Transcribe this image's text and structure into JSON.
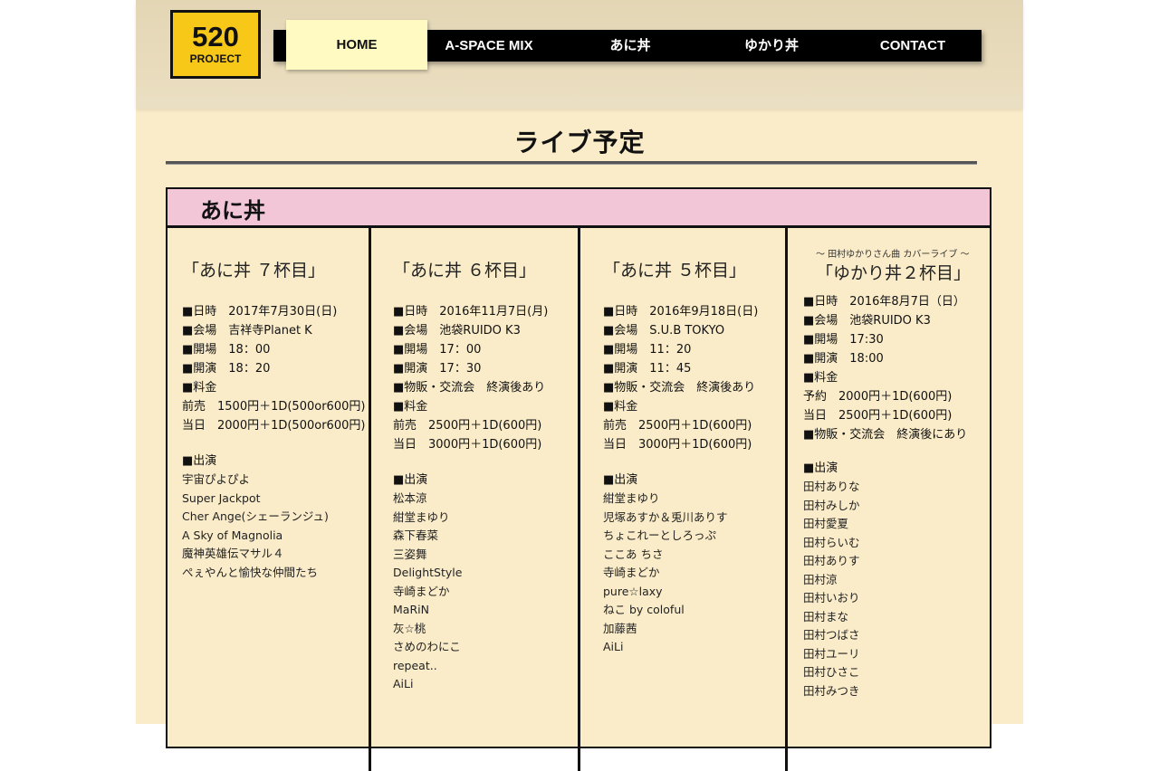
{
  "header": {
    "logo": {
      "number": "520",
      "sub": "PROJECT"
    },
    "nav": [
      {
        "label": "HOME",
        "active": true
      },
      {
        "label": "A-SPACE MIX",
        "active": false
      },
      {
        "label": "あに丼",
        "active": false
      },
      {
        "label": "ゆかり丼",
        "active": false
      },
      {
        "label": "CONTACT",
        "active": false
      }
    ]
  },
  "page_title": "ライブ予定",
  "section": {
    "title": "あに丼",
    "header_color": "#f3c6d7",
    "events": [
      {
        "subtitle": "",
        "title": "「あに丼 ７杯目」",
        "details": [
          "■日時　2017年7月30日(日)",
          "■会場　吉祥寺Planet K",
          "■開場　18：00",
          "■開演　18：20",
          "■料金",
          "前売　1500円＋1D(500or600円)",
          "当日　2000円＋1D(500or600円)"
        ],
        "performers_label": "■出演",
        "performers": [
          "宇宙ぴよぴよ",
          "Super Jackpot",
          "Cher Ange(シェーランジュ)",
          "A Sky of Magnolia",
          "魔神英雄伝マサル４",
          "ぺぇやんと愉快な仲間たち"
        ]
      },
      {
        "subtitle": "",
        "title": "「あに丼 ６杯目」",
        "details": [
          "■日時　2016年11月7日(月)",
          "■会場　池袋RUIDO K3",
          "■開場　17：00",
          "■開演　17：30",
          "■物販・交流会　終演後あり",
          "■料金",
          "前売　2500円＋1D(600円)",
          "当日　3000円＋1D(600円)"
        ],
        "performers_label": "■出演",
        "performers": [
          "松本涼",
          "紺堂まゆり",
          "森下春菜",
          "三姿舞",
          "DelightStyle",
          "寺崎まどか",
          "MaRiN",
          "灰☆桃",
          "さめのわにこ",
          "repeat..",
          "AiLi"
        ]
      },
      {
        "subtitle": "",
        "title": "「あに丼 ５杯目」",
        "details": [
          "■日時　2016年9月18日(日)",
          "■会場　S.U.B TOKYO",
          "■開場　11：20",
          "■開演　11：45",
          "■物販・交流会　終演後あり",
          "■料金",
          "前売　2500円＋1D(600円)",
          "当日　3000円＋1D(600円)"
        ],
        "performers_label": "■出演",
        "performers": [
          "紺堂まゆり",
          "児塚あすか＆兎川ありす",
          "ちょこれーとしろっぷ",
          "ここあ ちさ",
          "寺崎まどか",
          "pure☆laxy",
          "ねこ by coloful",
          "加藤茜",
          "AiLi"
        ]
      },
      {
        "subtitle": "～ 田村ゆかりさん曲 カバーライブ ～",
        "title": "「ゆかり丼２杯目」",
        "details": [
          "■日時　2016年8月7日（日）",
          "■会場　池袋RUIDO K3",
          "■開場　17:30",
          "■開演　18:00",
          "■料金",
          "予約　2000円＋1D(600円)",
          "当日　2500円＋1D(600円)",
          "■物販・交流会　終演後にあり"
        ],
        "performers_label": "■出演",
        "performers": [
          "田村ありな",
          "田村みしか",
          "田村愛夏",
          "田村らいむ",
          "田村ありす",
          "田村涼",
          "田村いおり",
          "田村まな",
          "田村つばさ",
          "田村ユーリ",
          "田村ひさこ",
          "田村みつき"
        ]
      }
    ]
  }
}
